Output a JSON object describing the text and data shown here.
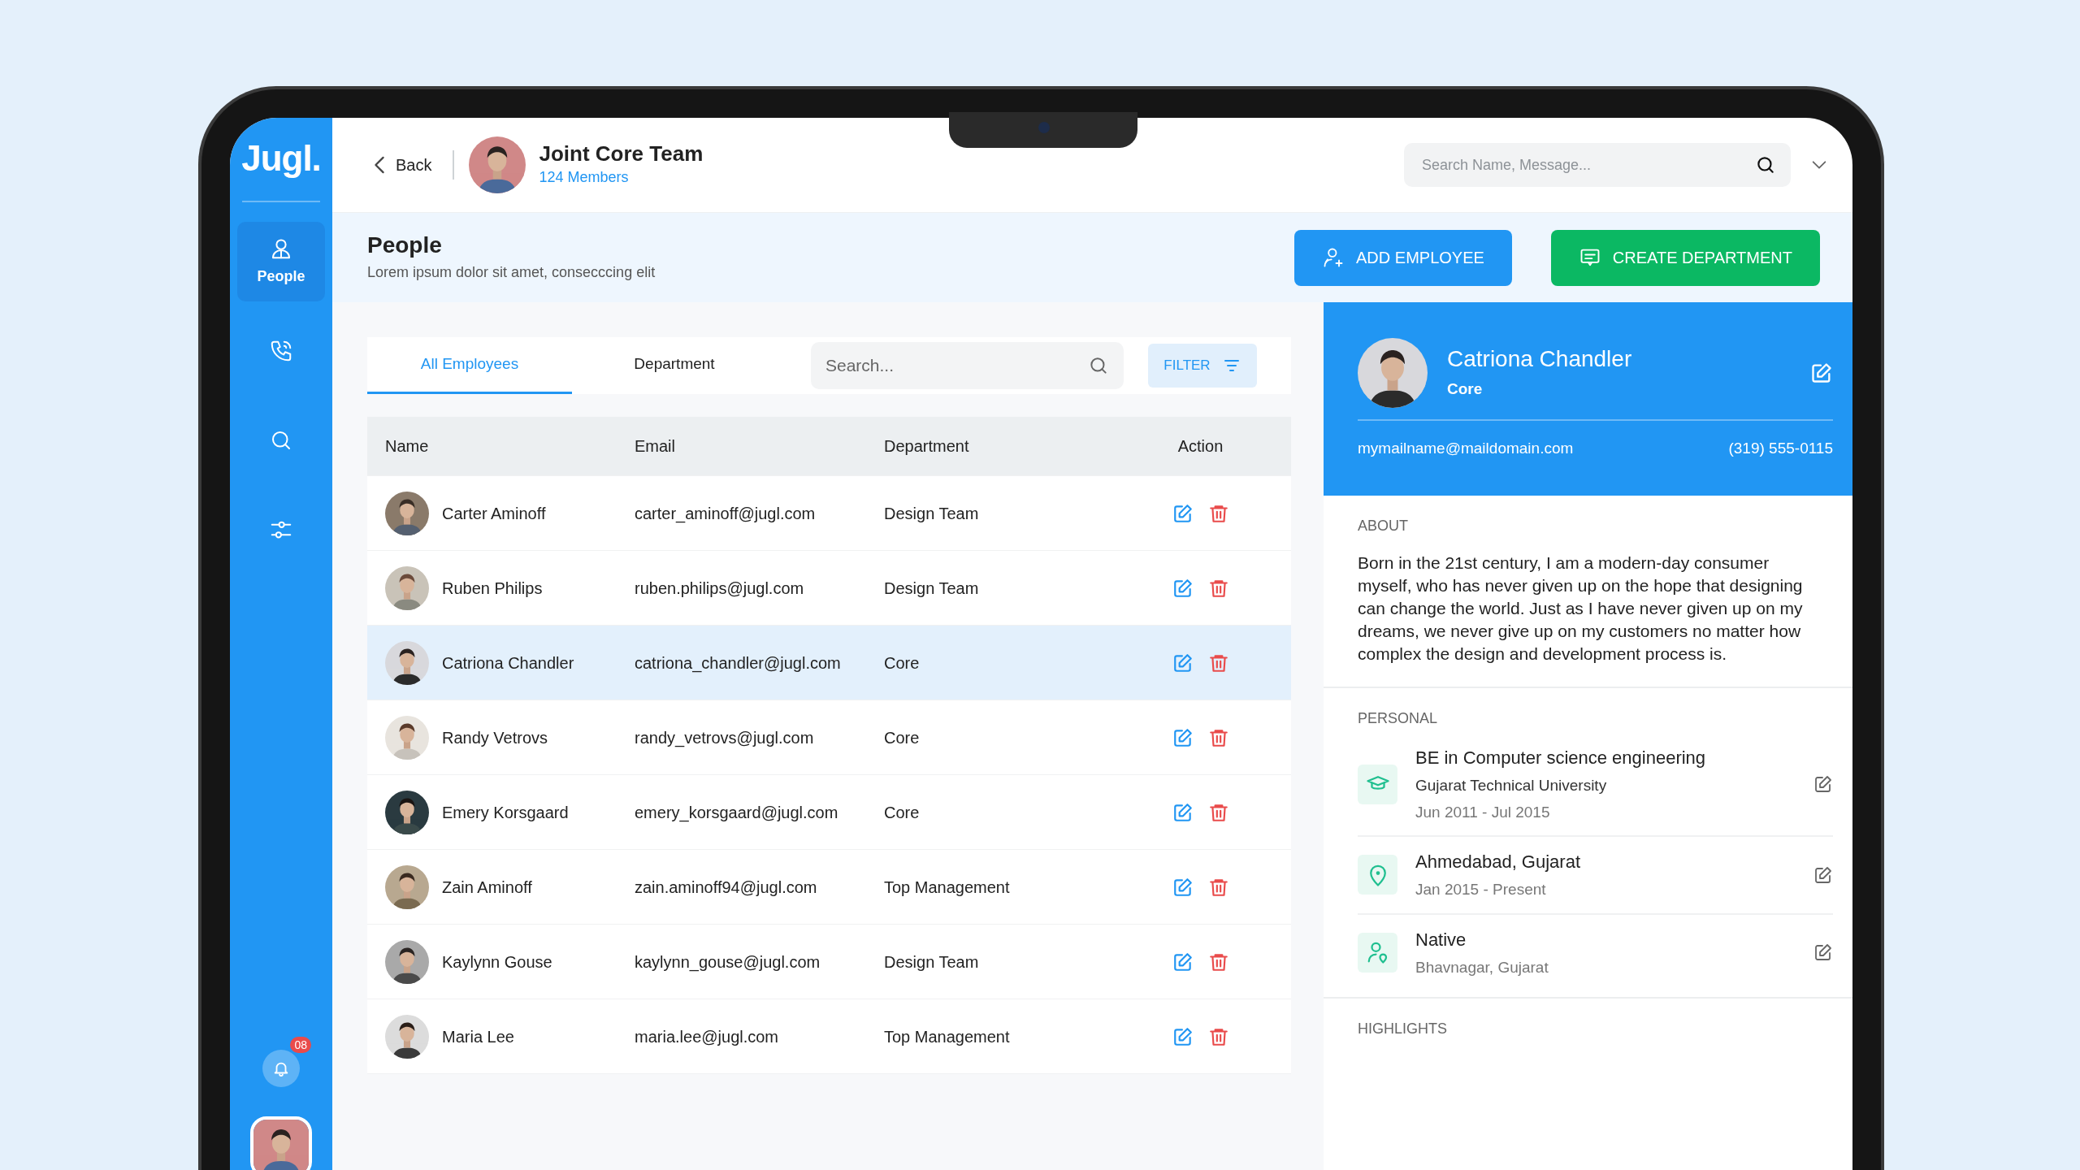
{
  "sidebar": {
    "logo": "Jugl.",
    "items": [
      {
        "kind": "people",
        "label": "People",
        "selected": true
      },
      {
        "kind": "phone",
        "selected": false
      },
      {
        "kind": "search",
        "selected": false
      },
      {
        "kind": "filters",
        "selected": false
      }
    ],
    "notifications": {
      "badge": "08"
    }
  },
  "header": {
    "back": "Back",
    "team": {
      "title": "Joint Core Team",
      "subtitle": "124 Members"
    },
    "search": {
      "placeholder": "Search Name, Message..."
    }
  },
  "page": {
    "title": "People",
    "subtitle": "Lorem ipsum dolor sit amet, consecccing elit",
    "buttons": [
      {
        "kind": "add-employee",
        "label": "ADD EMPLOYEE"
      },
      {
        "kind": "create-department",
        "label": "CREATE DEPARTMENT"
      }
    ]
  },
  "tabs": [
    {
      "label": "All Employees",
      "selected": true
    },
    {
      "label": "Department",
      "selected": false
    }
  ],
  "search": {
    "placeholder": "Search..."
  },
  "filter": {
    "label": "FILTER"
  },
  "table": {
    "columns": [
      "Name",
      "Email",
      "Department",
      "Action"
    ],
    "rows": [
      {
        "name": "Carter Aminoff",
        "email": "carter_aminoff@jugl.com",
        "department": "Design Team",
        "selected": false
      },
      {
        "name": "Ruben Philips",
        "email": "ruben.philips@jugl.com",
        "department": "Design Team",
        "selected": false
      },
      {
        "name": "Catriona Chandler",
        "email": "catriona_chandler@jugl.com",
        "department": "Core",
        "selected": true
      },
      {
        "name": "Randy Vetrovs",
        "email": "randy_vetrovs@jugl.com",
        "department": "Core",
        "selected": false
      },
      {
        "name": "Emery Korsgaard",
        "email": "emery_korsgaard@jugl.com",
        "department": "Core",
        "selected": false
      },
      {
        "name": "Zain Aminoff",
        "email": "zain.aminoff94@jugl.com",
        "department": "Top Management",
        "selected": false
      },
      {
        "name": "Kaylynn Gouse",
        "email": "kaylynn_gouse@jugl.com",
        "department": "Design Team",
        "selected": false
      },
      {
        "name": "Maria Lee",
        "email": "maria.lee@jugl.com",
        "department": "Top Management",
        "selected": false
      }
    ]
  },
  "profile": {
    "name": "Catriona Chandler",
    "department": "Core",
    "email": "mymailname@maildomain.com",
    "phone": "(319) 555-0115",
    "about_label": "ABOUT",
    "about": "Born in the 21st century, I am a modern-day consumer myself, who has never given up on the hope that designing can change the world. Just as I have never given up on my dreams, we never give up on my customers no matter how complex the design and development process is.",
    "personal_label": "PERSONAL",
    "personal": [
      {
        "kind": "education",
        "title": "BE in Computer science engineering",
        "subtitle": "Gujarat Technical University",
        "note": "Jun 2011 - Jul 2015"
      },
      {
        "kind": "location",
        "title": "Ahmedabad, Gujarat",
        "note": "Jan 2015 - Present"
      },
      {
        "kind": "native",
        "title": "Native",
        "note": "Bhavnagar, Gujarat"
      }
    ],
    "highlights_label": "HIGHLIGHTS"
  }
}
